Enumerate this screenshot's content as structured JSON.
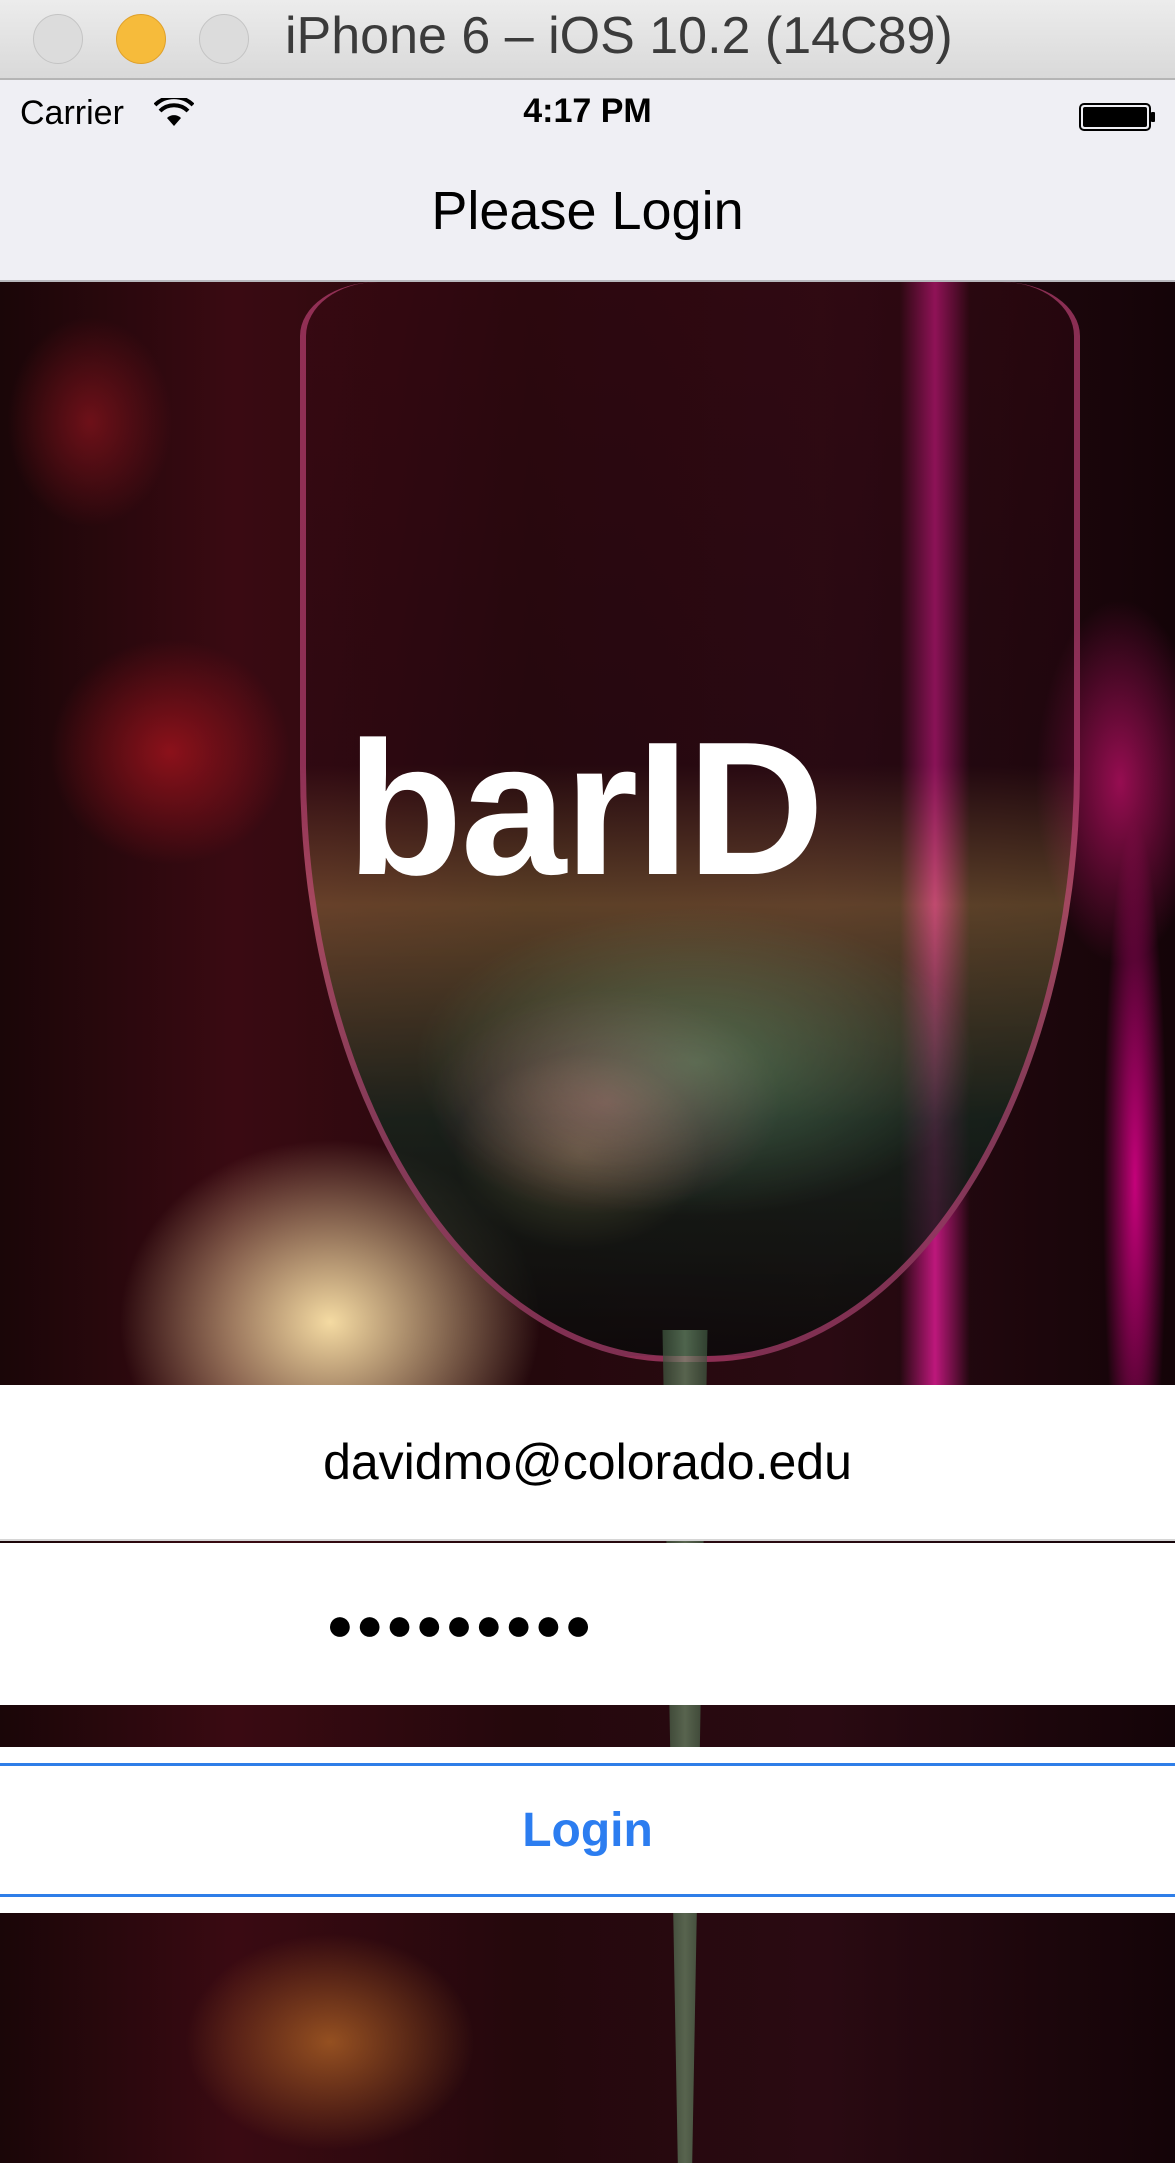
{
  "simulator": {
    "title": "iPhone 6 – iOS 10.2 (14C89)"
  },
  "status_bar": {
    "carrier": "Carrier",
    "time": "4:17 PM",
    "wifi_icon": "wifi-icon",
    "battery_icon": "battery-full-icon"
  },
  "nav": {
    "title": "Please Login"
  },
  "hero": {
    "logo": "barID"
  },
  "form": {
    "email_value": "davidmo@colorado.edu",
    "password_value": "●●●●●●●●●",
    "login_label": "Login"
  },
  "colors": {
    "accent": "#2c7df0",
    "traffic_minimize": "#f6bb3b",
    "nav_bg": "#efeff4"
  }
}
